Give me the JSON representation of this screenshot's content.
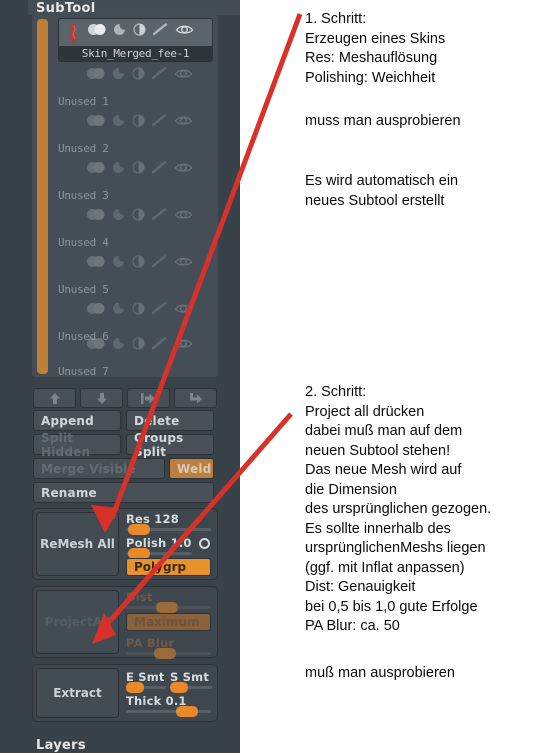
{
  "panel": {
    "title": "SubTool",
    "bottom_title": "Layers",
    "scrollbar_name": "subtool-list-scrollbar"
  },
  "subtools": [
    {
      "label": "Skin_Merged_fee-1",
      "active": true
    },
    {
      "label": "Unused  1",
      "active": false
    },
    {
      "label": "Unused  2",
      "active": false
    },
    {
      "label": "Unused  3",
      "active": false
    },
    {
      "label": "Unused  4",
      "active": false
    },
    {
      "label": "Unused  5",
      "active": false
    },
    {
      "label": "Unused  6",
      "active": false
    },
    {
      "label": "Unused  7",
      "active": false
    }
  ],
  "slot_icons": [
    "copy-spheres-icon",
    "crescent-icon",
    "half-circle-icon",
    "brush-stroke-icon",
    "eye-icon"
  ],
  "arrow_buttons": [
    {
      "name": "move-up-button",
      "glyph": "arrow-up-icon"
    },
    {
      "name": "move-down-button",
      "glyph": "arrow-down-icon"
    },
    {
      "name": "move-right-button",
      "glyph": "arrow-right-icon"
    },
    {
      "name": "duplicate-button",
      "glyph": "arrow-corner-icon"
    }
  ],
  "buttons": {
    "append": "Append",
    "delete": "Delete",
    "split_hidden": "Split Hidden",
    "groups_split": "Groups Split",
    "merge_visible": "Merge Visible",
    "weld": "Weld",
    "rename": "Rename"
  },
  "remesh": {
    "button": "ReMesh  All",
    "res_label": "Res 128",
    "res_value": 128,
    "polish_label": "Polish 1.0",
    "polygrp_label": "Polygrp",
    "circle_icon": "circle-toggle-icon"
  },
  "project": {
    "button": "ProjectAll",
    "dist_label": "Dist",
    "maximum_label": "Maximum",
    "pa_blur_label": "PA Blur"
  },
  "extract": {
    "button": "Extract",
    "e_smt_label": "E Smt",
    "s_smt_label": "S Smt",
    "thick_label": "Thick 0.1",
    "thick_value": 0.1
  },
  "notes": {
    "note1": "1. Schritt:\nErzeugen eines Skins\nRes: Meshauflösung\nPolishing: Weichheit",
    "note2": "muss man ausprobieren",
    "note3": "Es wird automatisch ein\nneues Subtool erstellt",
    "note4": "2. Schritt:\nProject all drücken\ndabei muß man auf dem\nneuen Subtool stehen!\nDas neue Mesh wird auf\ndie Dimension\ndes ursprünglichen gezogen.\nEs sollte innerhalb des\nursprünglichenMeshs liegen\n(ggf. mit Inflat anpassen)\nDist: Genauigkeit\nbei 0,5 bis 1,0 gute Erfolge\nPA Blur: ca. 50",
    "note5": "muß man ausprobieren"
  },
  "colors": {
    "panel_bg": "#3a4249",
    "accent_orange": "#e8922e",
    "arrow_red": "#d8312a",
    "text_light": "#d2d7db"
  }
}
